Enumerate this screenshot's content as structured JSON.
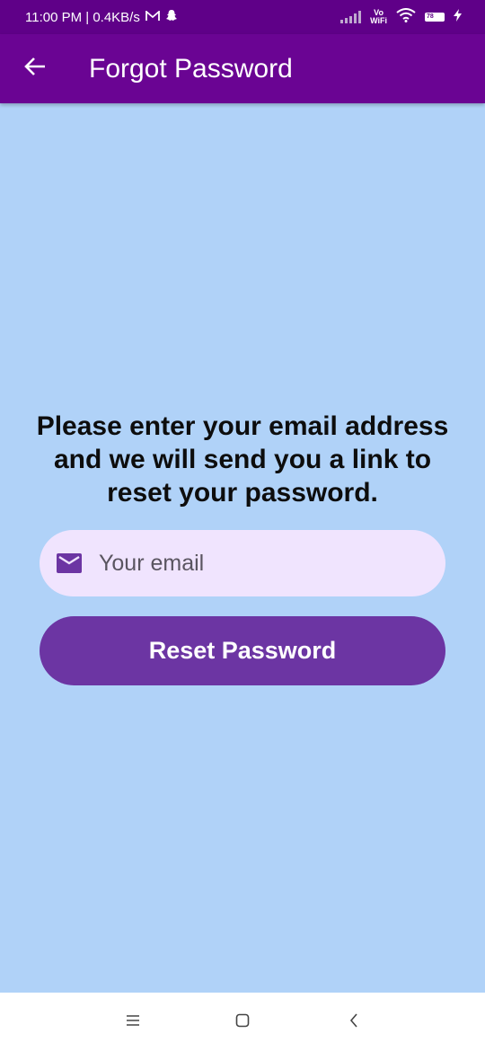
{
  "status_bar": {
    "time_info": "11:00 PM | 0.4KB/s",
    "network_top": "Vo",
    "network_bottom": "WiFi",
    "battery": "78"
  },
  "app_bar": {
    "title": "Forgot Password",
    "back_icon": "arrow-back-icon"
  },
  "main": {
    "message": "Please enter your email address and we will send you a link to reset your password.",
    "email_field": {
      "placeholder": "Your email",
      "value": "",
      "icon": "mail-icon"
    },
    "reset_button_label": "Reset Password"
  },
  "nav_bar": {
    "menu_icon": "menu-icon",
    "home_icon": "home-icon",
    "back_icon": "back-icon"
  },
  "colors": {
    "status_bar": "#5f0088",
    "app_bar": "#6a0493",
    "background": "#b0d2f8",
    "field_background": "#f0e4fe",
    "button": "#6c35a3",
    "icon_accent": "#6c35a3"
  }
}
